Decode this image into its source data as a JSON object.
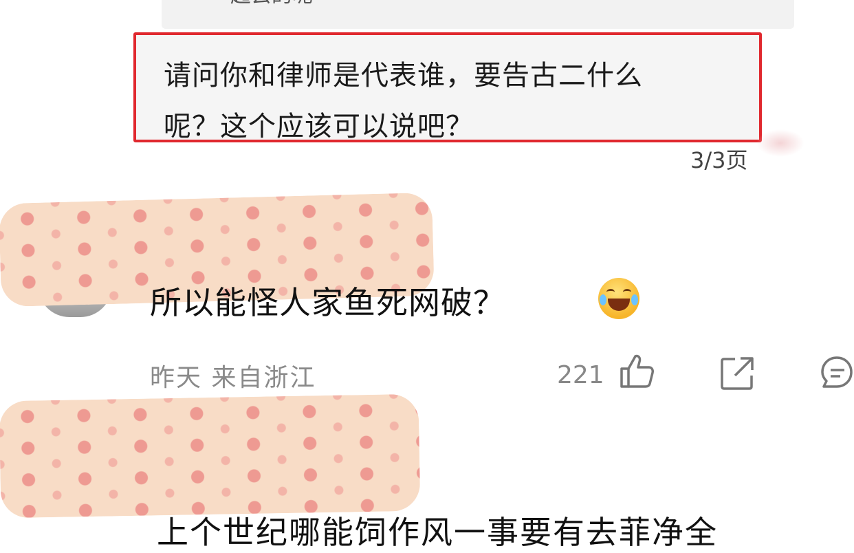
{
  "previous_quote": {
    "text": "一起去的呢"
  },
  "quoted_reply": {
    "line1": "请问你和律师是代表谁，要告古二什么",
    "line2": "呢？这个应该可以说吧？",
    "highlight_color": "#e0282e"
  },
  "page_indicator": "3/3页",
  "comment": {
    "text": "所以能怪人家鱼死网破？",
    "emoji": "laughing-crying-emoji",
    "time": "昨天",
    "location": "来自浙江",
    "like_count": "221"
  },
  "next_comment": {
    "text_partial": "上个世纪哪能饲作风一事要有去菲净全"
  },
  "colors": {
    "sticker_bg": "#f8dcc6",
    "meta_gray": "#8a8a8a"
  }
}
